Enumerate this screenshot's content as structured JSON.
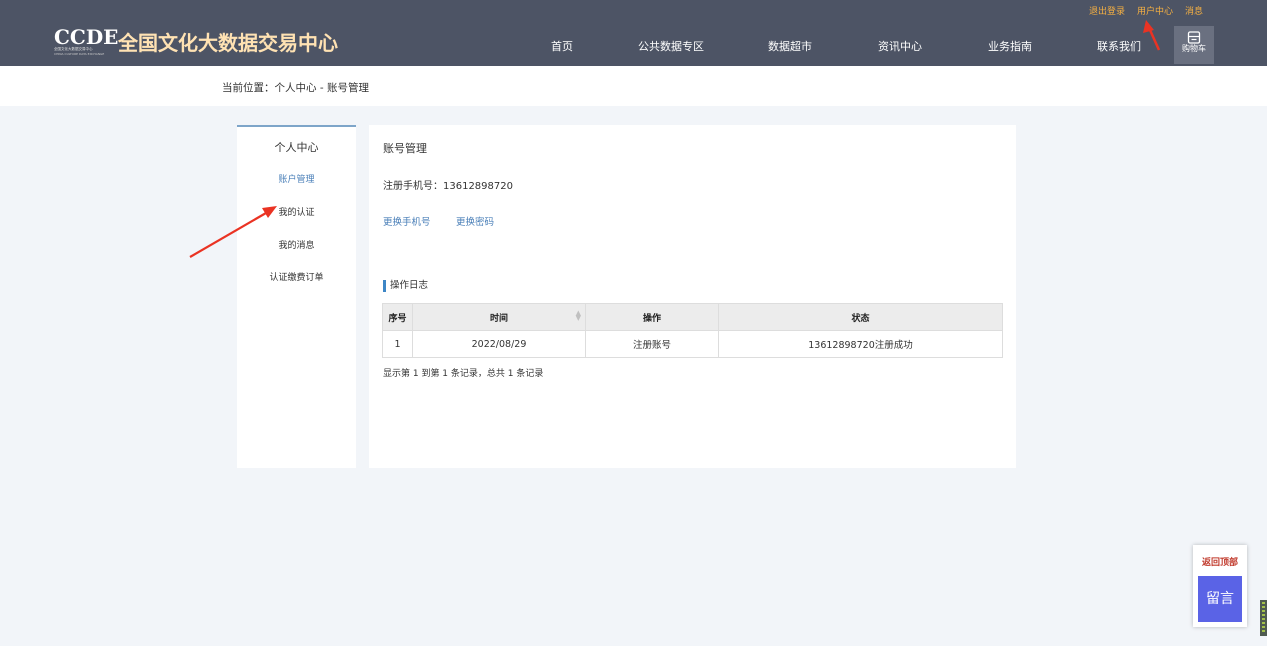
{
  "header": {
    "logo": {
      "mark": "CCDE",
      "sub_cn": "全国文化大数据交易中心",
      "sub_en": "CHINA CULTURE DATA EXCHANGE",
      "title": "全国文化大数据交易中心"
    },
    "top_links": [
      "退出登录",
      "用户中心",
      "消息"
    ],
    "nav": [
      "首页",
      "公共数据专区",
      "数据超市",
      "资讯中心",
      "业务指南",
      "联系我们"
    ],
    "cart": {
      "label": "购物车",
      "icon": "cart-icon"
    }
  },
  "breadcrumb": "当前位置：个人中心 - 账号管理",
  "sidebar": {
    "title": "个人中心",
    "items": [
      "账户管理",
      "我的认证",
      "我的消息",
      "认证缴费订单"
    ],
    "active": "账户管理"
  },
  "main": {
    "title": "账号管理",
    "phone_label": "注册手机号：",
    "phone_value": "13612898720",
    "links": [
      "更换手机号",
      "更换密码"
    ],
    "log": {
      "title": "操作日志",
      "columns": [
        "序号",
        "时间",
        "操作",
        "状态"
      ],
      "rows": [
        [
          "1",
          "2022/08/29",
          "注册账号",
          "13612898720注册成功"
        ]
      ],
      "pagination": "显示第 1 到第 1 条记录，总共 1 条记录"
    }
  },
  "floating": {
    "back_to_top": "返回顶部",
    "message": "留言"
  },
  "colors": {
    "header_bg": "#4d5465",
    "top_link": "#f5b042",
    "link": "#4a7fb8",
    "message_button": "#5a63e6",
    "annotation_arrow": "#ea3323"
  }
}
